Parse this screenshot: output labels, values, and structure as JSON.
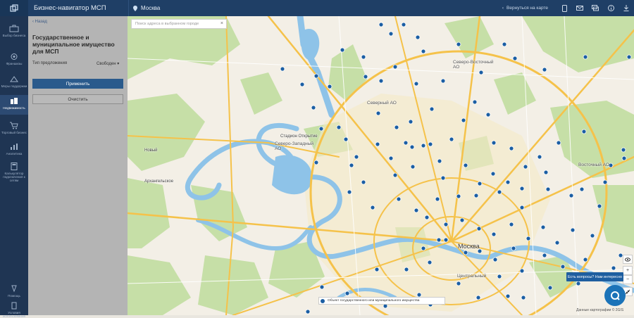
{
  "app": {
    "title": "Бизнес-навигатор МСП",
    "city": "Москва",
    "back_to_map": "Вернуться на карте"
  },
  "sidebar": {
    "items": [
      {
        "label": "Выбор бизнеса",
        "icon": "briefcase-icon"
      },
      {
        "label": "Франшизы",
        "icon": "franchise-icon"
      },
      {
        "label": "Меры поддержки",
        "icon": "support-icon"
      },
      {
        "label": "Недвижимость",
        "icon": "building-icon",
        "active": true
      },
      {
        "label": "Торговый бизнес",
        "icon": "cart-icon"
      },
      {
        "label": "Аналитика",
        "icon": "analytics-icon"
      },
      {
        "label": "Калькулятор подключения к сетям",
        "icon": "calculator-icon"
      },
      {
        "label": "Помощь",
        "icon": "help-icon"
      },
      {
        "label": "Условия использования",
        "icon": "terms-icon"
      }
    ]
  },
  "panel": {
    "back": "Назад",
    "title": "Государственное и муниципальное имущество для МСП",
    "type_label": "Тип предложения",
    "type_value": "Свободен",
    "apply": "Применить",
    "clear": "Очистить"
  },
  "map": {
    "search_placeholder": "Поиск адреса в выбранном городе",
    "labels": {
      "moscow": "Москва",
      "sever_vost": "Северо-Восточный АО",
      "severny": "Северный АО",
      "sever_zap": "Северо-Западный АО",
      "vostochny": "Восточный АО",
      "centralny": "Центральный",
      "arkhangelskoe": "Архангельское",
      "novy": "Новый",
      "otkrytie": "Стадион Открытие"
    },
    "footer_note": "Объект государственного или муниципального имущества",
    "help_button": "Есть вопросы? Нам интересно",
    "attribution": "Данные картографии © 2GIS",
    "colors": {
      "marker": "#1b5ea3",
      "park": "#c6dfa7",
      "water": "#8ec3e8",
      "road": "#f5c24a",
      "background": "#f3efe6"
    }
  }
}
